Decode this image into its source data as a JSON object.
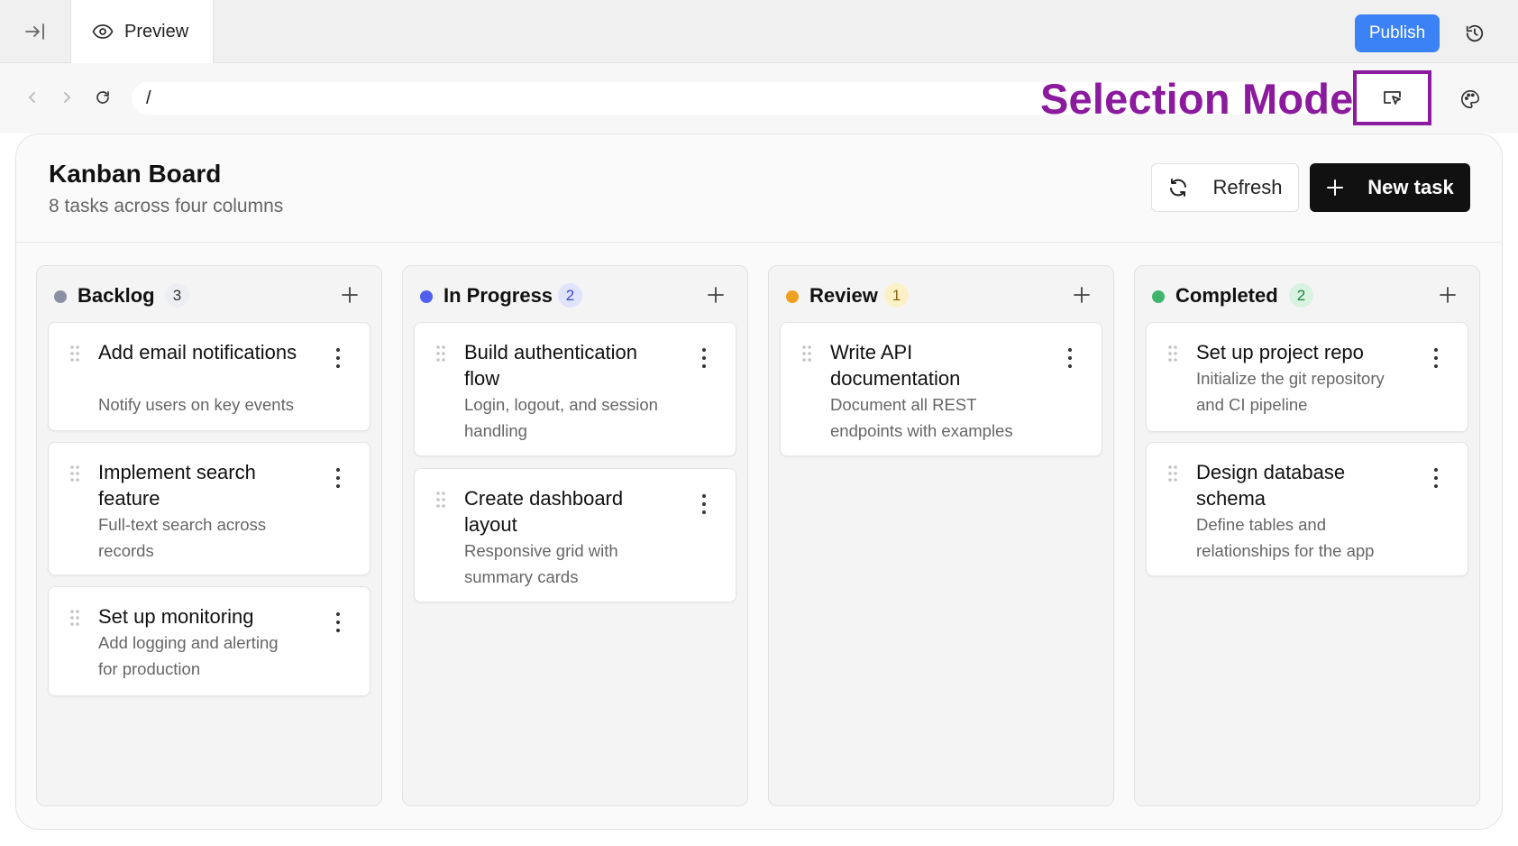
{
  "topbar": {
    "tab_label": "Preview",
    "publish_label": "Publish",
    "publish_color": "#3b82f6"
  },
  "addressbar": {
    "url": "/",
    "selection_mode_label": "Selection Mode",
    "selection_mode_color": "#8b1a9e"
  },
  "board": {
    "title": "Kanban Board",
    "subtitle": "8 tasks across four columns",
    "refresh_label": "Refresh",
    "new_task_label": "New task",
    "columns": [
      {
        "name": "Backlog",
        "count": "3",
        "dot_color": "#8b8fa3",
        "badge_bg": "#eceef3",
        "badge_fg": "#333333",
        "cards": [
          {
            "title": "Add email notifications",
            "description": "Notify users on key events"
          },
          {
            "title": "Implement search feature",
            "description": "Full-text search across records"
          },
          {
            "title": "Set up monitoring",
            "description": "Add logging and alerting for production"
          }
        ]
      },
      {
        "name": "In Progress",
        "count": "2",
        "dot_color": "#4f5ff0",
        "badge_bg": "#dfe3fb",
        "badge_fg": "#3b47c9",
        "cards": [
          {
            "title": "Build authentication flow",
            "description": "Login, logout, and session handling"
          },
          {
            "title": "Create dashboard layout",
            "description": "Responsive grid with summary cards"
          }
        ]
      },
      {
        "name": "Review",
        "count": "1",
        "dot_color": "#f0a020",
        "badge_bg": "#fbf1c7",
        "badge_fg": "#8a6410",
        "cards": [
          {
            "title": "Write API documentation",
            "description": "Document all REST endpoints with examples"
          }
        ]
      },
      {
        "name": "Completed",
        "count": "2",
        "dot_color": "#3fb56b",
        "badge_bg": "#d9f3e1",
        "badge_fg": "#23813f",
        "cards": [
          {
            "title": "Set up project repo",
            "description": "Initialize the git repository and CI pipeline"
          },
          {
            "title": "Design database schema",
            "description": "Define tables and relationships for the app"
          }
        ]
      }
    ]
  }
}
